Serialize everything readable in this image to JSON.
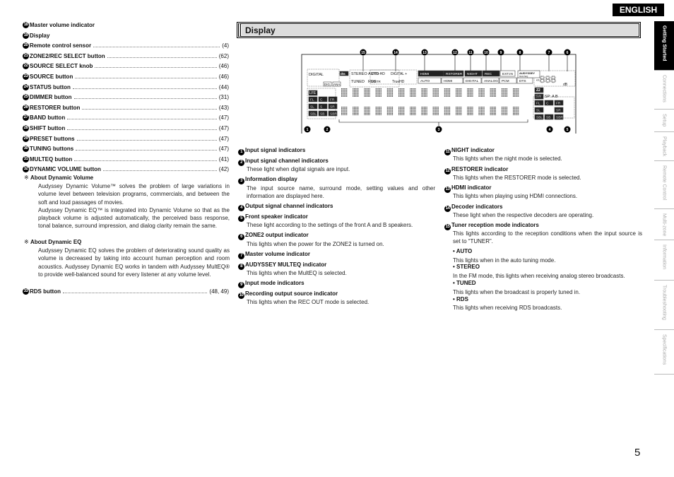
{
  "header": {
    "language": "ENGLISH",
    "section_title": "Display"
  },
  "sidebar": {
    "tabs": [
      {
        "label": "Getting Started",
        "active": true
      },
      {
        "label": "Connections"
      },
      {
        "label": "Setup"
      },
      {
        "label": "Playback"
      },
      {
        "label": "Remote Control"
      },
      {
        "label": "Multi-zone"
      },
      {
        "label": "Information"
      },
      {
        "label": "Troubleshooting"
      },
      {
        "label": "Specifications"
      }
    ]
  },
  "left": {
    "items": [
      {
        "n": "18",
        "label": "Master volume indicator",
        "page": ""
      },
      {
        "n": "19",
        "label": "Display",
        "page": ""
      },
      {
        "n": "20",
        "label": "Remote control sensor",
        "page": "(4)"
      },
      {
        "n": "21",
        "label": "ZONE2/REC SELECT button",
        "page": "(62)"
      },
      {
        "n": "22",
        "label": "SOURCE SELECT knob",
        "page": "(46)"
      },
      {
        "n": "23",
        "label": "SOURCE button",
        "page": "(46)"
      },
      {
        "n": "24",
        "label": "STATUS button",
        "page": "(44)"
      },
      {
        "n": "25",
        "label": "DIMMER button",
        "page": "(31)"
      },
      {
        "n": "26",
        "label": "RESTORER button",
        "page": "(43)"
      },
      {
        "n": "27",
        "label": "BAND button",
        "page": "(47)"
      },
      {
        "n": "28",
        "label": "SHIFT button",
        "page": "(47)"
      },
      {
        "n": "29",
        "label": "PRESET buttons",
        "page": "(47)"
      },
      {
        "n": "30",
        "label": "TUNING buttons",
        "page": "(47)"
      },
      {
        "n": "31",
        "label": "MULTEQ button",
        "page": "(41)"
      },
      {
        "n": "32",
        "label": "DYNAMIC VOLUME button",
        "page": "(42)"
      }
    ],
    "note_mark": "※",
    "notes": [
      {
        "title": "About Dynamic Volume",
        "paras": [
          "Audyssey Dynamic Volume™ solves the problem of large variations in volume level between television programs, commercials, and between the soft and loud passages of movies.",
          "Audyssey Dynamic EQ™ is integrated into Dynamic Volume so that as the playback volume is adjusted automatically, the perceived bass response, tonal balance, surround impression, and dialog clarity remain the same."
        ]
      },
      {
        "title": "About Dynamic EQ",
        "paras": [
          "Audyssey Dynamic EQ solves the problem of deteriorating sound quality as volume is decreased by taking into account human perception and room acoustics. Audyssey Dynamic EQ works in tandem with Audyssey MultEQ® to provide well-balanced sound for every listener at any volume level."
        ]
      }
    ],
    "last_item": {
      "n": "33",
      "label": "RDS button",
      "page": "(48, 49)"
    }
  },
  "middle": {
    "items": [
      {
        "n": "1",
        "label": "Input signal indicators",
        "desc": ""
      },
      {
        "n": "2",
        "label": "Input signal channel indicators",
        "desc": "These light when digital signals are input."
      },
      {
        "n": "3",
        "label": "Information display",
        "desc": "The input source name, surround mode, setting values and other information are displayed here."
      },
      {
        "n": "4",
        "label": "Output signal channel indicators",
        "desc": ""
      },
      {
        "n": "5",
        "label": "Front speaker indicator",
        "desc": "These light according to the settings of the front A and B speakers."
      },
      {
        "n": "6",
        "label": "ZONE2 output indicator",
        "desc": "This lights when the power for the ZONE2 is turned on."
      },
      {
        "n": "7",
        "label": "Master volume indicator",
        "desc": ""
      },
      {
        "n": "8",
        "label": "AUDYSSEY MULTEQ indicator",
        "desc": "This lights when the MultEQ is selected."
      },
      {
        "n": "9",
        "label": "Input mode indicators",
        "desc": ""
      },
      {
        "n": "10",
        "label": "Recording output source indicator",
        "desc": "This lights when the REC OUT mode is selected."
      }
    ]
  },
  "right": {
    "items": [
      {
        "n": "11",
        "label": "NIGHT indicator",
        "desc": "This lights when the night mode is selected."
      },
      {
        "n": "12",
        "label": "RESTORER indicator",
        "desc": "This lights when the RESTORER mode is selected."
      },
      {
        "n": "13",
        "label": "HDMI indicator",
        "desc": "This lights when playing using HDMI connections."
      },
      {
        "n": "14",
        "label": "Decoder indicators",
        "desc": "These light when the respective decoders are operating."
      },
      {
        "n": "15",
        "label": "Tuner reception mode indicators",
        "desc": "This lights according to the reception conditions when the input source is set to “TUNER”."
      }
    ],
    "bullets": [
      {
        "label": "• AUTO",
        "desc": "This lights when in the auto tuning mode."
      },
      {
        "label": "• STEREO",
        "desc": "In the FM mode, this lights when receiving analog stereo broadcasts."
      },
      {
        "label": "• TUNED",
        "desc": "This lights when the broadcast is properly tuned in."
      },
      {
        "label": "• RDS",
        "desc": "This lights when receiving RDS broadcasts."
      }
    ]
  },
  "display_diagram": {
    "callouts_top": [
      "15",
      "14",
      "13",
      "12",
      "11",
      "10",
      "9",
      "8",
      "7",
      "6"
    ],
    "callouts_bottom": [
      "1",
      "2",
      "3",
      "4",
      "5"
    ],
    "labels": {
      "digital": "DIGITAL",
      "dts": "dts",
      "dig": "DIG.",
      "ana": "ANA.",
      "stereo": "STEREO",
      "auto": "AUTO",
      "tuned": "TUNED",
      "rds": "RDS",
      "dtshd": "DTS-HD",
      "dplus": "DIGITAL +",
      "mstr": "MSTR",
      "truehd": "TrueHD",
      "hdmi": "HDMI",
      "auto2": "AUTO",
      "hdmi2": "HDMI",
      "digital2": "DIGITAL",
      "restorer": "RSTORER",
      "night": "NIGHT",
      "analog": "ANALOG",
      "rec": "REC",
      "pcm": "PCM",
      "extin": "EXT.IN",
      "dts2": "DTS",
      "audyssey": "AUDYSSEY",
      "multeq": "MULTEQ",
      "vol": "-888",
      "db": "dB",
      "z2": "Z2",
      "sw": "SW",
      "sp": "SP: A B",
      "lfe": "LFE",
      "in_ch": [
        "FL",
        "C",
        "FR",
        "SL",
        "S",
        "SR",
        "SBL",
        "SB",
        "SBR"
      ],
      "out_ch": [
        "FL",
        "C",
        "FR",
        "SL",
        "",
        "SR",
        "SBL",
        "SB",
        "SBR"
      ]
    }
  },
  "page_number": "5"
}
